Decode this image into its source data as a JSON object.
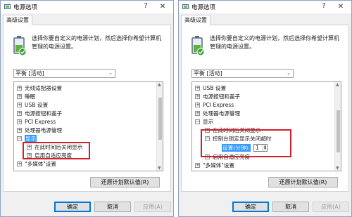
{
  "window": {
    "title": "电源选项",
    "help_glyph": "?",
    "close_glyph": "✕"
  },
  "tab": {
    "label": "高级设置"
  },
  "description": "选择你要自定义的电源计划，然后选择你希望计算机管理的电源设置。",
  "plan_select": {
    "value": "平衡 [活动]",
    "arrow": "⌄"
  },
  "icons": {
    "tree_expand": "⊞",
    "tree_collapse": "⊟",
    "battery": "battery-check-icon"
  },
  "colors": {
    "selection": "#3399ff",
    "highlight_box": "#d21f2b",
    "default_button_border": "#0078d7"
  },
  "left_tree": [
    {
      "label": "无线适配器设置",
      "state": "collapsed"
    },
    {
      "label": "睡眠",
      "state": "collapsed"
    },
    {
      "label": "USB 设置",
      "state": "collapsed"
    },
    {
      "label": "电源按钮和盖子",
      "state": "collapsed"
    },
    {
      "label": "PCI Express",
      "state": "collapsed"
    },
    {
      "label": "处理器电源管理",
      "state": "collapsed"
    },
    {
      "label": "显示",
      "state": "expanded",
      "selected": true
    },
    {
      "label": "在此时间后关闭显示",
      "state": "collapsed"
    },
    {
      "label": "启用自适应亮度",
      "state": "collapsed"
    },
    {
      "label": "\"多媒体\"设置",
      "state": "collapsed"
    }
  ],
  "right_tree": [
    {
      "label": "USB 设置",
      "state": "collapsed"
    },
    {
      "label": "电源按钮和盖子",
      "state": "collapsed"
    },
    {
      "label": "PCI Express",
      "state": "collapsed"
    },
    {
      "label": "处理器电源管理",
      "state": "collapsed"
    },
    {
      "label": "显示",
      "state": "expanded"
    },
    {
      "label": "在此时间后关闭显示",
      "state": "collapsed"
    },
    {
      "label": "控制台锁定显示关闭超时",
      "state": "expanded"
    },
    {
      "label": "设置(分钟):",
      "value": "1",
      "selected": true
    },
    {
      "label": "启用自适应亮度",
      "state": "collapsed"
    },
    {
      "label": "\"多媒体\"设置",
      "state": "collapsed"
    }
  ],
  "buttons": {
    "restore": "还原计划默认值(R)",
    "ok": "确定",
    "cancel": "取消",
    "apply": "应用(A)"
  }
}
